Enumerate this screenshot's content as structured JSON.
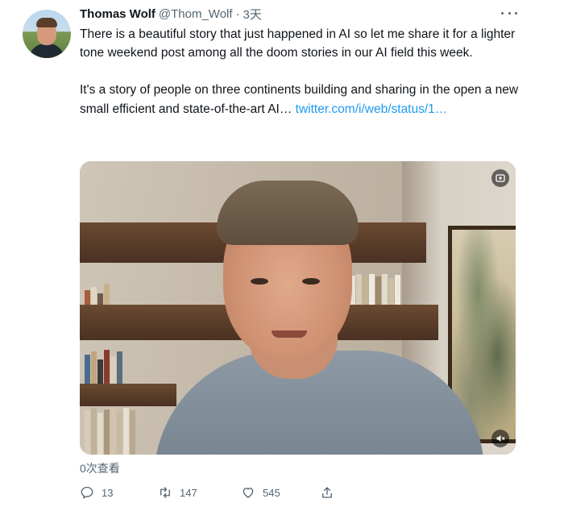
{
  "author": {
    "name": "Thomas Wolf",
    "handle": "@Thom_Wolf",
    "separator": "·",
    "time": "3天"
  },
  "tweet": {
    "paragraph1": "There is a beautiful story that just happened in AI so let me share it for a lighter tone weekend post among all the doom stories in our AI field this week.",
    "paragraph2_text": "It's a story of people on three continents building and sharing in the open a new small efficient and state-of-the-art AI… ",
    "paragraph2_link": "twitter.com/i/web/status/1…"
  },
  "media": {
    "type": "video",
    "gif_icon": "settings-icon",
    "mute_icon": "volume-icon"
  },
  "views": "0次查看",
  "actions": {
    "reply_count": "13",
    "retweet_count": "147",
    "like_count": "545"
  },
  "colors": {
    "link": "#1d9bf0",
    "secondary_text": "#536471",
    "primary_text": "#0f1419"
  }
}
